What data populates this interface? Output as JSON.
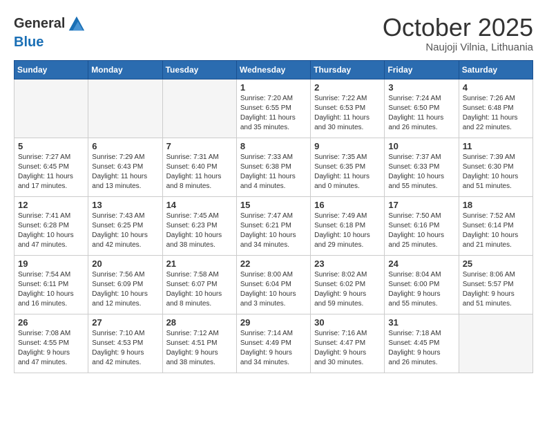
{
  "header": {
    "logo_line1": "General",
    "logo_line2": "Blue",
    "month": "October 2025",
    "location": "Naujoji Vilnia, Lithuania"
  },
  "weekdays": [
    "Sunday",
    "Monday",
    "Tuesday",
    "Wednesday",
    "Thursday",
    "Friday",
    "Saturday"
  ],
  "weeks": [
    [
      {
        "day": "",
        "info": ""
      },
      {
        "day": "",
        "info": ""
      },
      {
        "day": "",
        "info": ""
      },
      {
        "day": "1",
        "info": "Sunrise: 7:20 AM\nSunset: 6:55 PM\nDaylight: 11 hours\nand 35 minutes."
      },
      {
        "day": "2",
        "info": "Sunrise: 7:22 AM\nSunset: 6:53 PM\nDaylight: 11 hours\nand 30 minutes."
      },
      {
        "day": "3",
        "info": "Sunrise: 7:24 AM\nSunset: 6:50 PM\nDaylight: 11 hours\nand 26 minutes."
      },
      {
        "day": "4",
        "info": "Sunrise: 7:26 AM\nSunset: 6:48 PM\nDaylight: 11 hours\nand 22 minutes."
      }
    ],
    [
      {
        "day": "5",
        "info": "Sunrise: 7:27 AM\nSunset: 6:45 PM\nDaylight: 11 hours\nand 17 minutes."
      },
      {
        "day": "6",
        "info": "Sunrise: 7:29 AM\nSunset: 6:43 PM\nDaylight: 11 hours\nand 13 minutes."
      },
      {
        "day": "7",
        "info": "Sunrise: 7:31 AM\nSunset: 6:40 PM\nDaylight: 11 hours\nand 8 minutes."
      },
      {
        "day": "8",
        "info": "Sunrise: 7:33 AM\nSunset: 6:38 PM\nDaylight: 11 hours\nand 4 minutes."
      },
      {
        "day": "9",
        "info": "Sunrise: 7:35 AM\nSunset: 6:35 PM\nDaylight: 11 hours\nand 0 minutes."
      },
      {
        "day": "10",
        "info": "Sunrise: 7:37 AM\nSunset: 6:33 PM\nDaylight: 10 hours\nand 55 minutes."
      },
      {
        "day": "11",
        "info": "Sunrise: 7:39 AM\nSunset: 6:30 PM\nDaylight: 10 hours\nand 51 minutes."
      }
    ],
    [
      {
        "day": "12",
        "info": "Sunrise: 7:41 AM\nSunset: 6:28 PM\nDaylight: 10 hours\nand 47 minutes."
      },
      {
        "day": "13",
        "info": "Sunrise: 7:43 AM\nSunset: 6:25 PM\nDaylight: 10 hours\nand 42 minutes."
      },
      {
        "day": "14",
        "info": "Sunrise: 7:45 AM\nSunset: 6:23 PM\nDaylight: 10 hours\nand 38 minutes."
      },
      {
        "day": "15",
        "info": "Sunrise: 7:47 AM\nSunset: 6:21 PM\nDaylight: 10 hours\nand 34 minutes."
      },
      {
        "day": "16",
        "info": "Sunrise: 7:49 AM\nSunset: 6:18 PM\nDaylight: 10 hours\nand 29 minutes."
      },
      {
        "day": "17",
        "info": "Sunrise: 7:50 AM\nSunset: 6:16 PM\nDaylight: 10 hours\nand 25 minutes."
      },
      {
        "day": "18",
        "info": "Sunrise: 7:52 AM\nSunset: 6:14 PM\nDaylight: 10 hours\nand 21 minutes."
      }
    ],
    [
      {
        "day": "19",
        "info": "Sunrise: 7:54 AM\nSunset: 6:11 PM\nDaylight: 10 hours\nand 16 minutes."
      },
      {
        "day": "20",
        "info": "Sunrise: 7:56 AM\nSunset: 6:09 PM\nDaylight: 10 hours\nand 12 minutes."
      },
      {
        "day": "21",
        "info": "Sunrise: 7:58 AM\nSunset: 6:07 PM\nDaylight: 10 hours\nand 8 minutes."
      },
      {
        "day": "22",
        "info": "Sunrise: 8:00 AM\nSunset: 6:04 PM\nDaylight: 10 hours\nand 3 minutes."
      },
      {
        "day": "23",
        "info": "Sunrise: 8:02 AM\nSunset: 6:02 PM\nDaylight: 9 hours\nand 59 minutes."
      },
      {
        "day": "24",
        "info": "Sunrise: 8:04 AM\nSunset: 6:00 PM\nDaylight: 9 hours\nand 55 minutes."
      },
      {
        "day": "25",
        "info": "Sunrise: 8:06 AM\nSunset: 5:57 PM\nDaylight: 9 hours\nand 51 minutes."
      }
    ],
    [
      {
        "day": "26",
        "info": "Sunrise: 7:08 AM\nSunset: 4:55 PM\nDaylight: 9 hours\nand 47 minutes."
      },
      {
        "day": "27",
        "info": "Sunrise: 7:10 AM\nSunset: 4:53 PM\nDaylight: 9 hours\nand 42 minutes."
      },
      {
        "day": "28",
        "info": "Sunrise: 7:12 AM\nSunset: 4:51 PM\nDaylight: 9 hours\nand 38 minutes."
      },
      {
        "day": "29",
        "info": "Sunrise: 7:14 AM\nSunset: 4:49 PM\nDaylight: 9 hours\nand 34 minutes."
      },
      {
        "day": "30",
        "info": "Sunrise: 7:16 AM\nSunset: 4:47 PM\nDaylight: 9 hours\nand 30 minutes."
      },
      {
        "day": "31",
        "info": "Sunrise: 7:18 AM\nSunset: 4:45 PM\nDaylight: 9 hours\nand 26 minutes."
      },
      {
        "day": "",
        "info": ""
      }
    ]
  ]
}
